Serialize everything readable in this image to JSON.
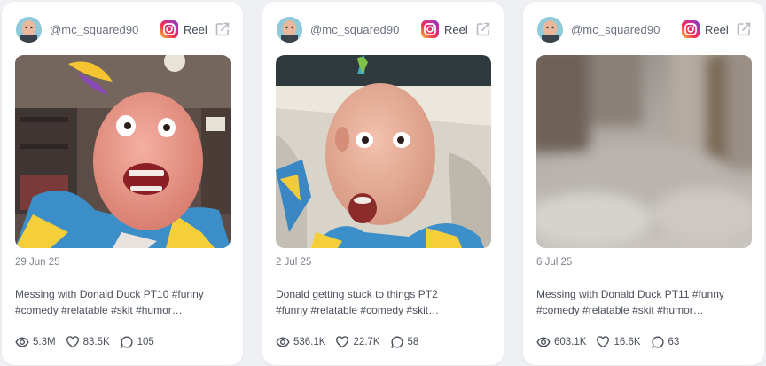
{
  "cards": [
    {
      "handle": "@mc_squared90",
      "type_label": "Reel",
      "date": "29 Jun 25",
      "caption_line1": "Messing with Donald Duck PT10 #funny",
      "caption_line2": "#comedy #relatable #skit #humor…",
      "views": "5.3M",
      "likes": "83.5K",
      "comments": "105"
    },
    {
      "handle": "@mc_squared90",
      "type_label": "Reel",
      "date": "2 Jul 25",
      "caption_line1": "Donald getting stuck to things PT2",
      "caption_line2": "#funny #relatable #comedy #skit…",
      "views": "536.1K",
      "likes": "22.7K",
      "comments": "58"
    },
    {
      "handle": "@mc_squared90",
      "type_label": "Reel",
      "date": "6 Jul 25",
      "caption_line1": "Messing with Donald Duck PT11 #funny",
      "caption_line2": "#comedy #relatable #skit #humor…",
      "views": "603.1K",
      "likes": "16.6K",
      "comments": "63"
    }
  ],
  "icons": {
    "avatar": "avatar",
    "platform": "instagram-icon",
    "external": "external-link-icon",
    "views": "eye-icon",
    "likes": "heart-icon",
    "comments": "comment-icon"
  },
  "colors": {
    "page_background": "#eef0f3",
    "card_background": "#ffffff",
    "text_muted": "#7d8290",
    "text_body": "#4a4f5c"
  }
}
